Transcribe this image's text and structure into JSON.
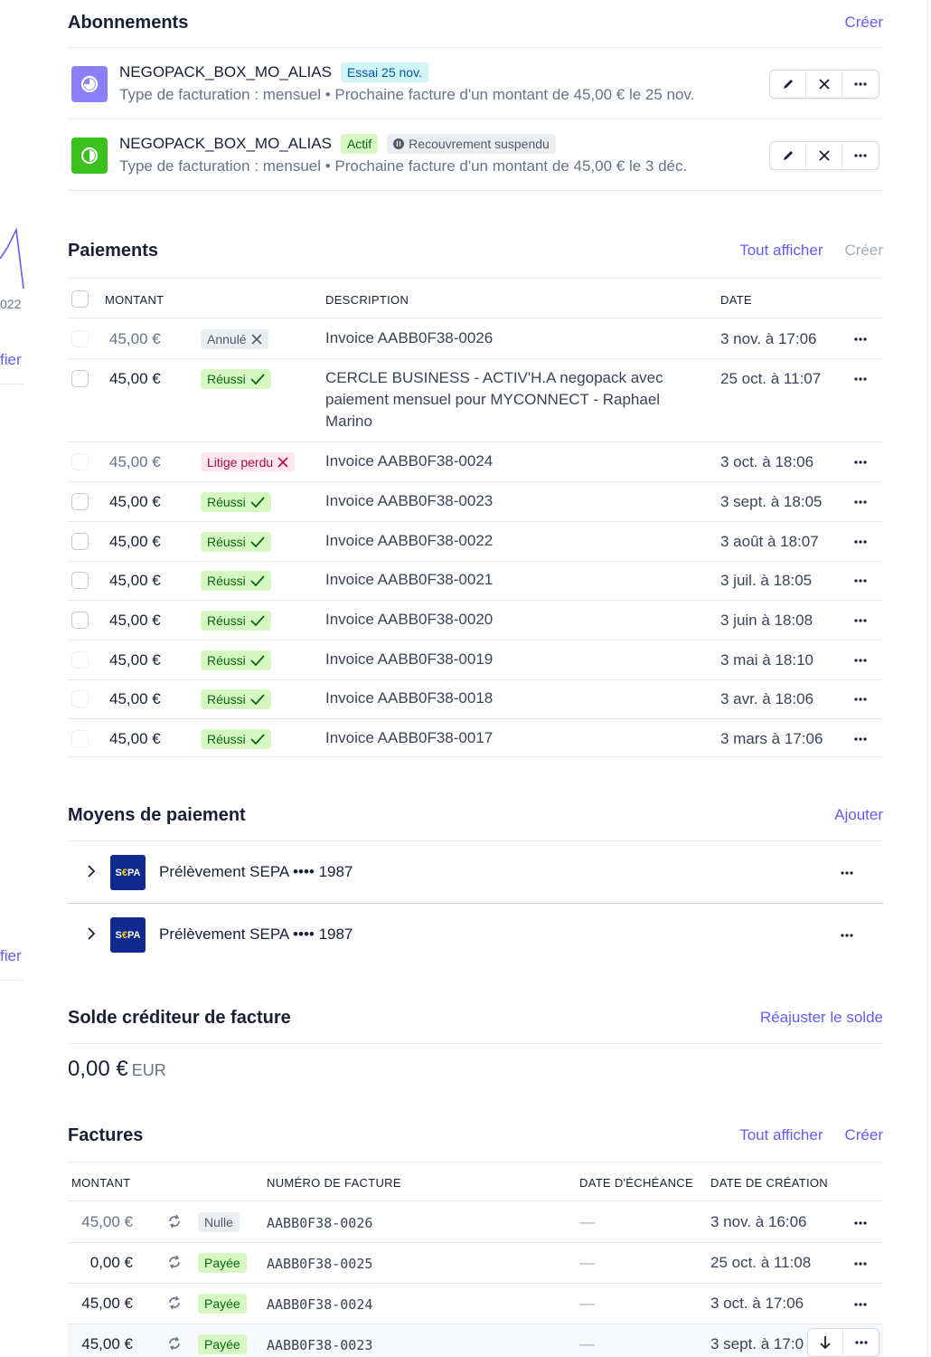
{
  "left_fragments": {
    "year": "022",
    "link1": "fier",
    "link2": "fier"
  },
  "subscriptions": {
    "title": "Abonnements",
    "create": "Créer",
    "items": [
      {
        "name": "NEGOPACK_BOX_MO_ALIAS",
        "badge": "Essai 25 nov.",
        "meta": "Type de facturation : mensuel • Prochaine facture d'un montant de 45,00 € le 25 nov.",
        "icon_color": "#8d7ffa"
      },
      {
        "name": "NEGOPACK_BOX_MO_ALIAS",
        "badge": "Actif",
        "badge2": "Recouvrement suspendu",
        "meta": "Type de facturation : mensuel • Prochaine facture d'un montant de 45,00 € le 3 déc.",
        "icon_color": "#3ac11b"
      }
    ]
  },
  "payments": {
    "title": "Paiements",
    "view_all": "Tout afficher",
    "create": "Créer",
    "columns": {
      "amount": "MONTANT",
      "description": "DESCRIPTION",
      "date": "DATE"
    },
    "rows": [
      {
        "amount": "45,00 €",
        "status": "Annulé",
        "description": "Invoice AABB0F38-0026",
        "date": "3 nov. à 17:06"
      },
      {
        "amount": "45,00 €",
        "status": "Réussi",
        "description": "CERCLE BUSINESS - ACTIV'H.A negopack avec paiement mensuel pour MYCONNECT - Raphael Marino",
        "date": "25 oct. à 11:07"
      },
      {
        "amount": "45,00 €",
        "status": "Litige perdu",
        "description": "Invoice AABB0F38-0024",
        "date": "3 oct. à 18:06"
      },
      {
        "amount": "45,00 €",
        "status": "Réussi",
        "description": "Invoice AABB0F38-0023",
        "date": "3 sept. à 18:05"
      },
      {
        "amount": "45,00 €",
        "status": "Réussi",
        "description": "Invoice AABB0F38-0022",
        "date": "3 août à 18:07"
      },
      {
        "amount": "45,00 €",
        "status": "Réussi",
        "description": "Invoice AABB0F38-0021",
        "date": "3 juil. à 18:05"
      },
      {
        "amount": "45,00 €",
        "status": "Réussi",
        "description": "Invoice AABB0F38-0020",
        "date": "3 juin à 18:08"
      },
      {
        "amount": "45,00 €",
        "status": "Réussi",
        "description": "Invoice AABB0F38-0019",
        "date": "3 mai à 18:10"
      },
      {
        "amount": "45,00 €",
        "status": "Réussi",
        "description": "Invoice AABB0F38-0018",
        "date": "3 avr. à 18:06"
      },
      {
        "amount": "45,00 €",
        "status": "Réussi",
        "description": "Invoice AABB0F38-0017",
        "date": "3 mars à 17:06"
      }
    ]
  },
  "payment_methods": {
    "title": "Moyens de paiement",
    "add": "Ajouter",
    "items": [
      {
        "logo": "SEPA",
        "label": "Prélèvement SEPA •••• 1987"
      },
      {
        "logo": "SEPA",
        "label": "Prélèvement SEPA •••• 1987"
      }
    ]
  },
  "credit_balance": {
    "title": "Solde créditeur de facture",
    "adjust": "Réajuster le solde",
    "amount": "0,00 €",
    "currency": "EUR"
  },
  "invoices": {
    "title": "Factures",
    "view_all": "Tout afficher",
    "create": "Créer",
    "columns": {
      "amount": "MONTANT",
      "number": "NUMÉRO DE FACTURE",
      "due": "DATE D'ÉCHÉANCE",
      "created": "DATE DE CRÉATION"
    },
    "rows": [
      {
        "amount": "45,00 €",
        "status": "Nulle",
        "number": "AABB0F38-0026",
        "due": "—",
        "created": "3 nov. à 16:06"
      },
      {
        "amount": "0,00 €",
        "status": "Payée",
        "number": "AABB0F38-0025",
        "due": "—",
        "created": "25 oct. à 11:08"
      },
      {
        "amount": "45,00 €",
        "status": "Payée",
        "number": "AABB0F38-0024",
        "due": "—",
        "created": "3 oct. à 17:06"
      },
      {
        "amount": "45,00 €",
        "status": "Payée",
        "number": "AABB0F38-0023",
        "due": "—",
        "created": "3 sept. à 17:0"
      }
    ]
  },
  "colors": {
    "accent": "#635bff",
    "success_bg": "#d7f7c2",
    "success_fg": "#05690d",
    "danger_fg": "#df1b41"
  }
}
